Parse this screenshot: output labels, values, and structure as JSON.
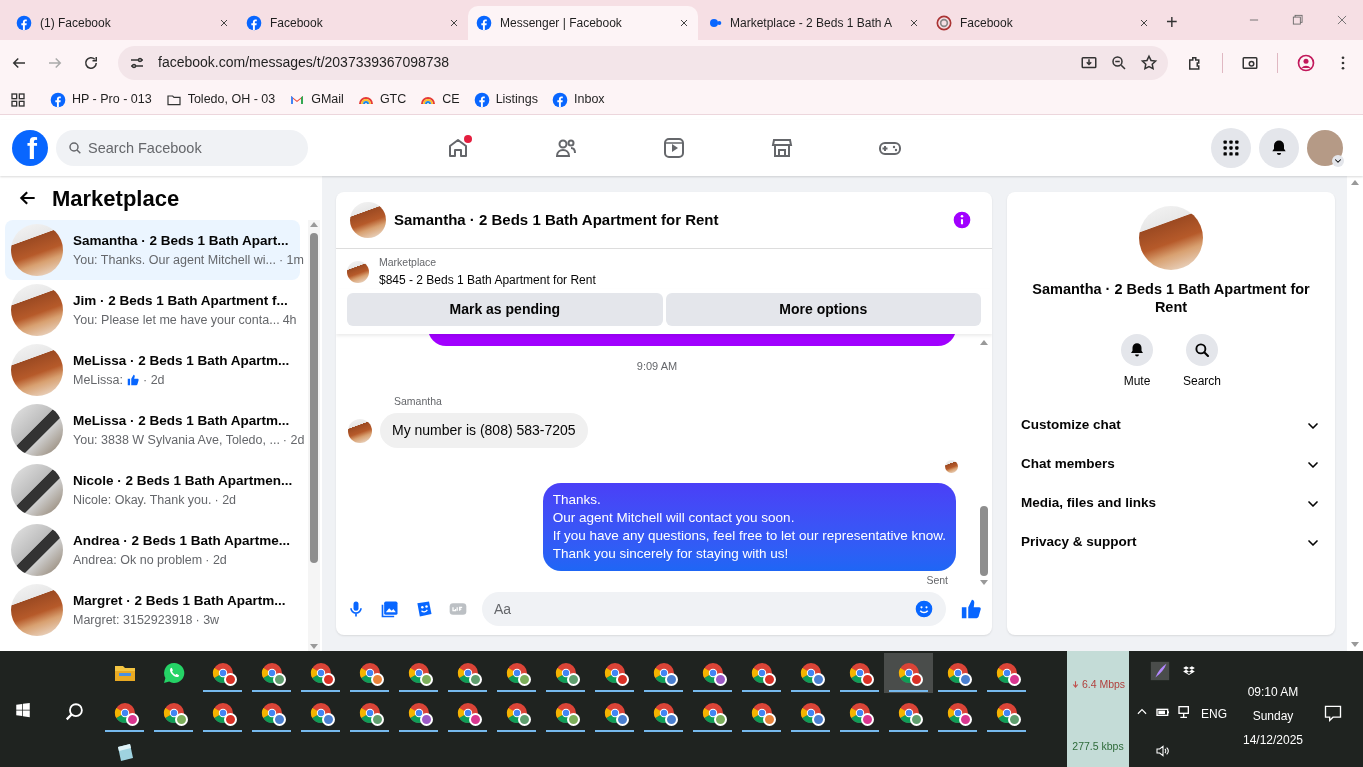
{
  "browser": {
    "tabs": [
      {
        "title": "(1) Facebook",
        "selected": false
      },
      {
        "title": "Facebook",
        "selected": false
      },
      {
        "title": "Messenger | Facebook",
        "selected": true
      },
      {
        "title": "Marketplace - 2 Beds 1 Bath A",
        "selected": false
      },
      {
        "title": "Facebook",
        "selected": false
      }
    ],
    "new_tab": "+",
    "url": "facebook.com/messages/t/2037339367098738",
    "bookmarks": [
      {
        "label": "HP - Pro - 013"
      },
      {
        "label": "Toledo, OH - 03"
      },
      {
        "label": "GMail"
      },
      {
        "label": "GTC"
      },
      {
        "label": "CE"
      },
      {
        "label": "Listings"
      },
      {
        "label": "Inbox"
      }
    ]
  },
  "facebook": {
    "logo": "f",
    "search_placeholder": "Search Facebook",
    "nav": [
      {
        "notification": true
      },
      {
        "notification": false
      },
      {
        "notification": false
      },
      {
        "notification": false
      },
      {
        "notification": false
      }
    ]
  },
  "sidebar": {
    "title": "Marketplace",
    "conversations": [
      {
        "name": "Samantha · 2 Beds 1 Bath Apart...",
        "preview": "You: Thanks. Our agent Mitchell wi...",
        "like": false,
        "time": "· 1m",
        "selected": true
      },
      {
        "name": "Jim · 2 Beds 1 Bath Apartment f...",
        "preview": "You: Please let me have your conta...",
        "like": false,
        "time": "4h",
        "selected": false
      },
      {
        "name": "MeLissa · 2 Beds 1 Bath Apartm...",
        "preview": "MeLissa:",
        "like": true,
        "time": "· 2d",
        "selected": false
      },
      {
        "name": "MeLissa · 2 Beds 1 Bath Apartm...",
        "preview": "You: 3838 W Sylvania Ave, Toledo, ...",
        "like": false,
        "time": "· 2d",
        "selected": false
      },
      {
        "name": "Nicole · 2 Beds 1 Bath Apartmen...",
        "preview": "Nicole: Okay. Thank you.",
        "like": false,
        "time": "· 2d",
        "selected": false
      },
      {
        "name": "Andrea · 2 Beds 1 Bath Apartme...",
        "preview": "Andrea: Ok no problem",
        "like": false,
        "time": "· 2d",
        "selected": false
      },
      {
        "name": "Margret · 2 Beds 1 Bath Apartm...",
        "preview": "Margret: 3152923918",
        "like": false,
        "time": "· 3w",
        "selected": false
      }
    ]
  },
  "chat": {
    "title": "Samantha · 2 Beds 1 Bath Apartment for Rent",
    "listing": {
      "label": "Marketplace",
      "title": "$845 - 2 Beds 1 Bath Apartment for Rent"
    },
    "buttons": [
      "Mark as pending",
      "More options"
    ],
    "timestamp": "9:09 AM",
    "messages": [
      {
        "kind": "received",
        "sender": "Samantha",
        "lines": [
          "My number is (808) 583-7205"
        ]
      },
      {
        "kind": "sent",
        "lines": [
          "Thanks.",
          "Our agent Mitchell will contact you soon.",
          "If you have any questions, feel free to let our representative know.",
          "Thank you sincerely for staying with us!"
        ],
        "status": "Sent"
      }
    ],
    "composer_placeholder": "Aa"
  },
  "details": {
    "title": "Samantha · 2 Beds 1 Bath Apartment for Rent",
    "actions": [
      "Mute",
      "Search"
    ],
    "sections": [
      {
        "label": "Customize chat",
        "expanded": false
      },
      {
        "label": "Chat members",
        "expanded": false
      },
      {
        "label": "Media, files and links",
        "expanded": false
      },
      {
        "label": "Privacy & support",
        "expanded": false
      }
    ]
  },
  "taskbar": {
    "rows": [
      [
        {
          "kind": "explorer",
          "running": false,
          "selected": false
        },
        {
          "kind": "whatsapp",
          "running": false,
          "selected": false
        },
        {
          "kind": "chrome",
          "color": "#d93025",
          "running": true,
          "selected": false
        },
        {
          "kind": "chrome",
          "color": "#5f9e6e",
          "running": true,
          "selected": false
        },
        {
          "kind": "chrome",
          "color": "#d93025",
          "running": true,
          "selected": false
        },
        {
          "kind": "chrome",
          "color": "#e8833a",
          "running": true,
          "selected": false
        },
        {
          "kind": "chrome",
          "color": "#7cae5a",
          "running": true,
          "selected": false
        },
        {
          "kind": "chrome",
          "color": "#5f9e6e",
          "running": true,
          "selected": false
        },
        {
          "kind": "chrome",
          "color": "#7cae5a",
          "running": true,
          "selected": false
        },
        {
          "kind": "chrome",
          "color": "#5f9e6e",
          "running": true,
          "selected": false
        },
        {
          "kind": "chrome",
          "color": "#d93025",
          "running": true,
          "selected": false
        },
        {
          "kind": "chrome",
          "color": "#4a7fd0",
          "running": true,
          "selected": false
        },
        {
          "kind": "chrome",
          "color": "#9b59c6",
          "running": true,
          "selected": false
        },
        {
          "kind": "chrome",
          "color": "#d93025",
          "running": true,
          "selected": false
        },
        {
          "kind": "chrome",
          "color": "#4a7fd0",
          "running": true,
          "selected": false
        },
        {
          "kind": "chrome",
          "color": "#d93025",
          "running": true,
          "selected": false
        },
        {
          "kind": "chrome",
          "color": "#d93025",
          "running": true,
          "selected": true
        },
        {
          "kind": "chrome",
          "color": "#4a7fd0",
          "running": true,
          "selected": false
        },
        {
          "kind": "chrome",
          "color": "#d9368f",
          "running": true,
          "selected": false
        }
      ],
      [
        {
          "kind": "chrome",
          "color": "#d9368f",
          "running": true,
          "selected": false
        },
        {
          "kind": "chrome",
          "color": "#7cae5a",
          "running": true,
          "selected": false
        },
        {
          "kind": "chrome",
          "color": "#d93025",
          "running": true,
          "selected": false
        },
        {
          "kind": "chrome",
          "color": "#4a7fd0",
          "running": true,
          "selected": false
        },
        {
          "kind": "chrome",
          "color": "#4a7fd0",
          "running": true,
          "selected": false
        },
        {
          "kind": "chrome",
          "color": "#5f9e6e",
          "running": true,
          "selected": false
        },
        {
          "kind": "chrome",
          "color": "#9b59c6",
          "running": true,
          "selected": false
        },
        {
          "kind": "chrome",
          "color": "#d9368f",
          "running": true,
          "selected": false
        },
        {
          "kind": "chrome",
          "color": "#5f9e6e",
          "running": true,
          "selected": false
        },
        {
          "kind": "chrome",
          "color": "#7cae5a",
          "running": true,
          "selected": false
        },
        {
          "kind": "chrome",
          "color": "#4a7fd0",
          "running": true,
          "selected": false
        },
        {
          "kind": "chrome",
          "color": "#4a7fd0",
          "running": true,
          "selected": false
        },
        {
          "kind": "chrome",
          "color": "#7cae5a",
          "running": true,
          "selected": false
        },
        {
          "kind": "chrome",
          "color": "#e8833a",
          "running": true,
          "selected": false
        },
        {
          "kind": "chrome",
          "color": "#4a7fd0",
          "running": true,
          "selected": false
        },
        {
          "kind": "chrome",
          "color": "#d9368f",
          "running": true,
          "selected": false
        },
        {
          "kind": "chrome",
          "color": "#5f9e6e",
          "running": true,
          "selected": false
        },
        {
          "kind": "chrome",
          "color": "#d9368f",
          "running": true,
          "selected": false
        },
        {
          "kind": "chrome",
          "color": "#5f9e6e",
          "running": true,
          "selected": false
        }
      ],
      [
        {
          "kind": "notes",
          "running": false,
          "selected": false
        }
      ]
    ],
    "download_speed": "6.4 Mbps",
    "upload_speed": "277.5 kbps",
    "language": "ENG",
    "time": "09:10 AM",
    "day": "Sunday",
    "date": "14/12/2025"
  }
}
